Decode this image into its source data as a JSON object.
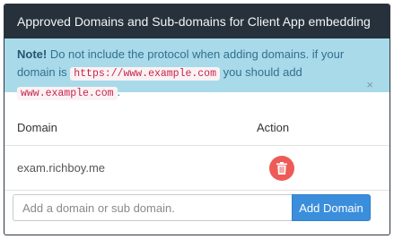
{
  "panel": {
    "title": "Approved Domains and Sub-domains for Client App embedding"
  },
  "alert": {
    "note_label": "Note!",
    "text_1": " Do not include the protocol when adding domains. if your domain is ",
    "code_1": "https://www.example.com",
    "text_2": " you should add ",
    "code_2": "www.example.com",
    "text_3": ".",
    "close_glyph": "×"
  },
  "table": {
    "headers": {
      "domain": "Domain",
      "action": "Action"
    },
    "rows": [
      {
        "domain": "exam.richboy.me",
        "action_icon": "trash-icon"
      }
    ]
  },
  "form": {
    "input_placeholder": "Add a domain or sub domain.",
    "input_value": "",
    "add_button_label": "Add Domain"
  },
  "colors": {
    "header_bg": "#27313b",
    "alert_bg": "#a9daea",
    "delete_button": "#ee5b57",
    "primary_button": "#3a8edb"
  }
}
